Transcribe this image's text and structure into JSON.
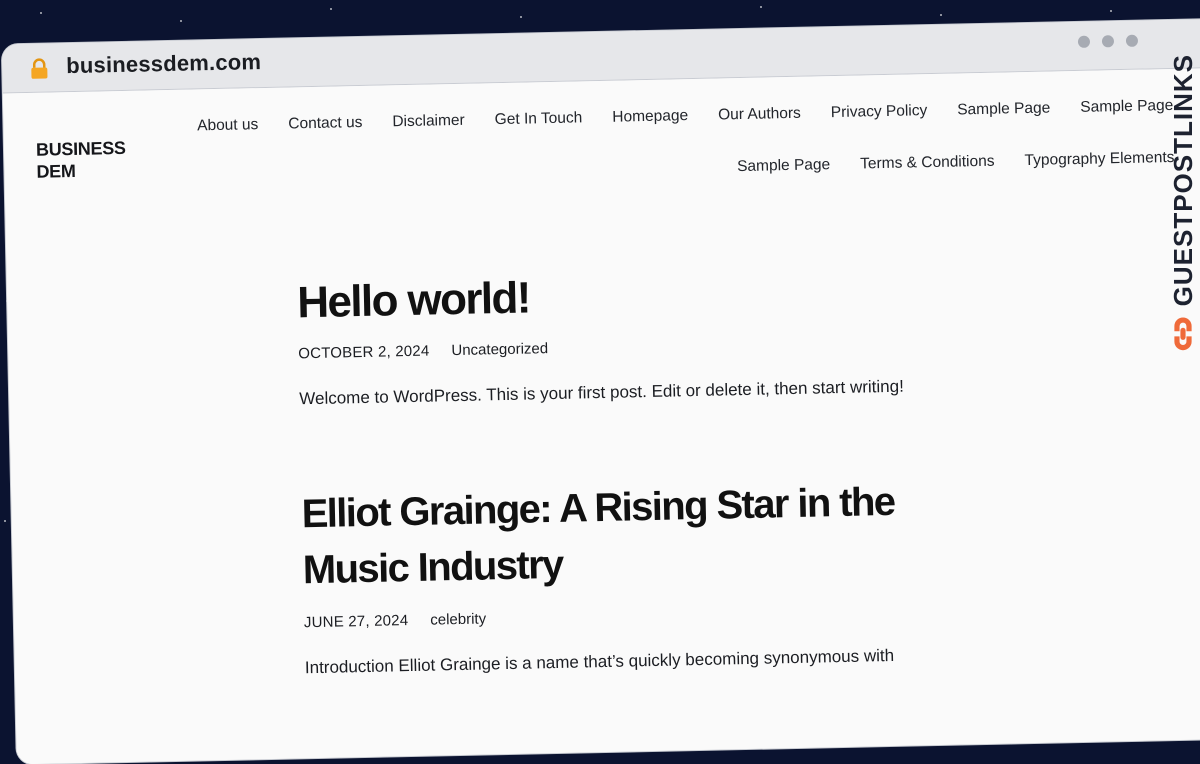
{
  "browser": {
    "url": "businessdem.com",
    "icons": {
      "lock": "lock-icon"
    }
  },
  "site": {
    "logo_lines": [
      "BUSINESS",
      "DEM"
    ],
    "nav_row1": [
      "About us",
      "Contact us",
      "Disclaimer",
      "Get In Touch",
      "Homepage",
      "Our Authors",
      "Privacy Policy",
      "Sample Page",
      "Sample Page"
    ],
    "nav_row2": [
      "Sample Page",
      "Terms & Conditions",
      "Typography Elements"
    ]
  },
  "posts": [
    {
      "title": "Hello world!",
      "date": "OCTOBER 2, 2024",
      "category": "Uncategorized",
      "excerpt": "Welcome to WordPress. This is your first post. Edit or delete it, then start writing!"
    },
    {
      "title": "Elliot Grainge: A Rising Star in the Music Industry",
      "date": "JUNE 27, 2024",
      "category": "celebrity",
      "excerpt": "Introduction  Elliot Grainge is a name that’s quickly becoming synonymous with"
    }
  ],
  "watermark": {
    "text": "GUESTPOSTLINKS",
    "accent": "#ef6a3a"
  },
  "colors": {
    "lock": "#f5a623",
    "background": "#0b1330"
  }
}
